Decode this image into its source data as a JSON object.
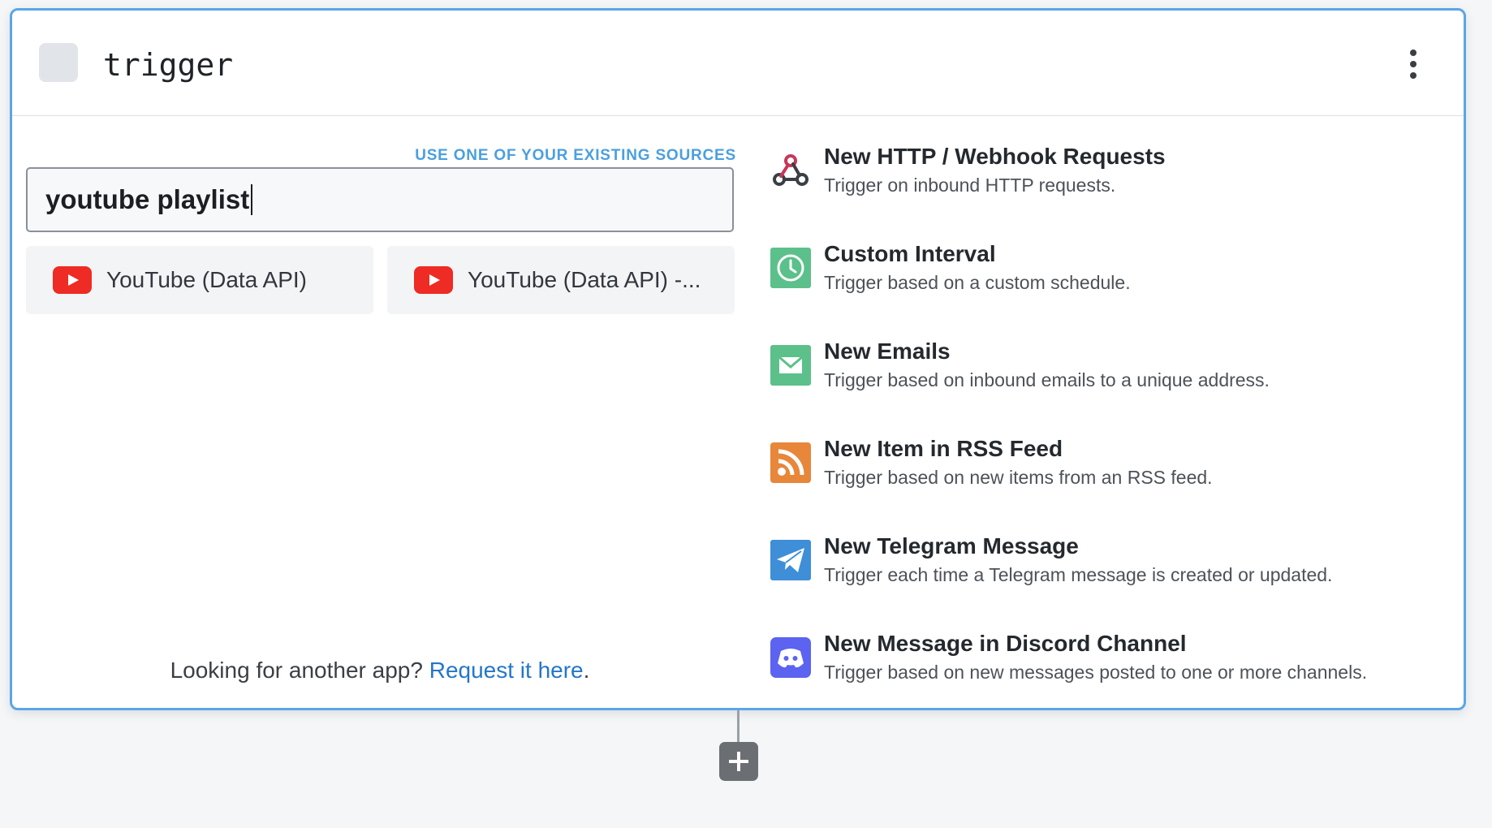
{
  "header": {
    "title": "trigger"
  },
  "search": {
    "existing_sources_link": "USE ONE OF YOUR EXISTING SOURCES",
    "value": "youtube playlist"
  },
  "app_results": [
    {
      "label": "YouTube (Data API)",
      "icon": "youtube-icon"
    },
    {
      "label": "YouTube (Data API) -...",
      "icon": "youtube-icon"
    }
  ],
  "request": {
    "prefix": "Looking for another app? ",
    "link": "Request it here",
    "suffix": "."
  },
  "sources": [
    {
      "title": "New HTTP / Webhook Requests",
      "description": "Trigger on inbound HTTP requests.",
      "icon": "webhook-icon"
    },
    {
      "title": "Custom Interval",
      "description": "Trigger based on a custom schedule.",
      "icon": "clock-icon",
      "color": "#5cc08a"
    },
    {
      "title": "New Emails",
      "description": "Trigger based on inbound emails to a unique address.",
      "icon": "email-icon",
      "color": "#5cc08a"
    },
    {
      "title": "New Item in RSS Feed",
      "description": "Trigger based on new items from an RSS feed.",
      "icon": "rss-icon",
      "color": "#e8863a"
    },
    {
      "title": "New Telegram Message",
      "description": "Trigger each time a Telegram message is created or updated.",
      "icon": "telegram-icon",
      "color": "#3e8ed8"
    },
    {
      "title": "New Message in Discord Channel",
      "description": "Trigger based on new messages posted to one or more channels.",
      "icon": "discord-icon",
      "color": "#5b63f0"
    }
  ],
  "colors": {
    "accent": "#5aa6e8",
    "link": "#2476c9",
    "youtube": "#ee2b24"
  }
}
